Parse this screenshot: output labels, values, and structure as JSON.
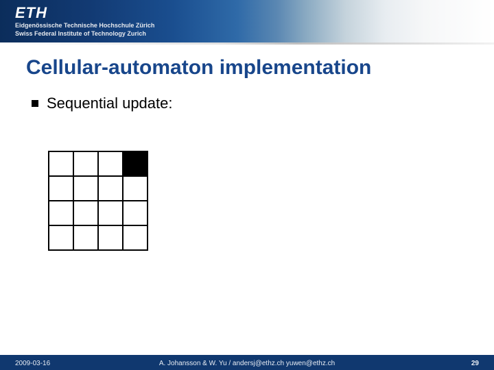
{
  "header": {
    "logo_text": "ETH",
    "institution_de": "Eidgenössische Technische Hochschule Zürich",
    "institution_en": "Swiss Federal Institute of Technology Zurich"
  },
  "title": "Cellular-automaton implementation",
  "bullet": {
    "text": "Sequential update:"
  },
  "grid": {
    "rows": 4,
    "cols": 4,
    "filled_cell": {
      "row": 0,
      "col": 3
    }
  },
  "footer": {
    "date": "2009-03-16",
    "authors": "A. Johansson & W. Yu / andersj@ethz.ch yuwen@ethz.ch",
    "page": "29"
  }
}
